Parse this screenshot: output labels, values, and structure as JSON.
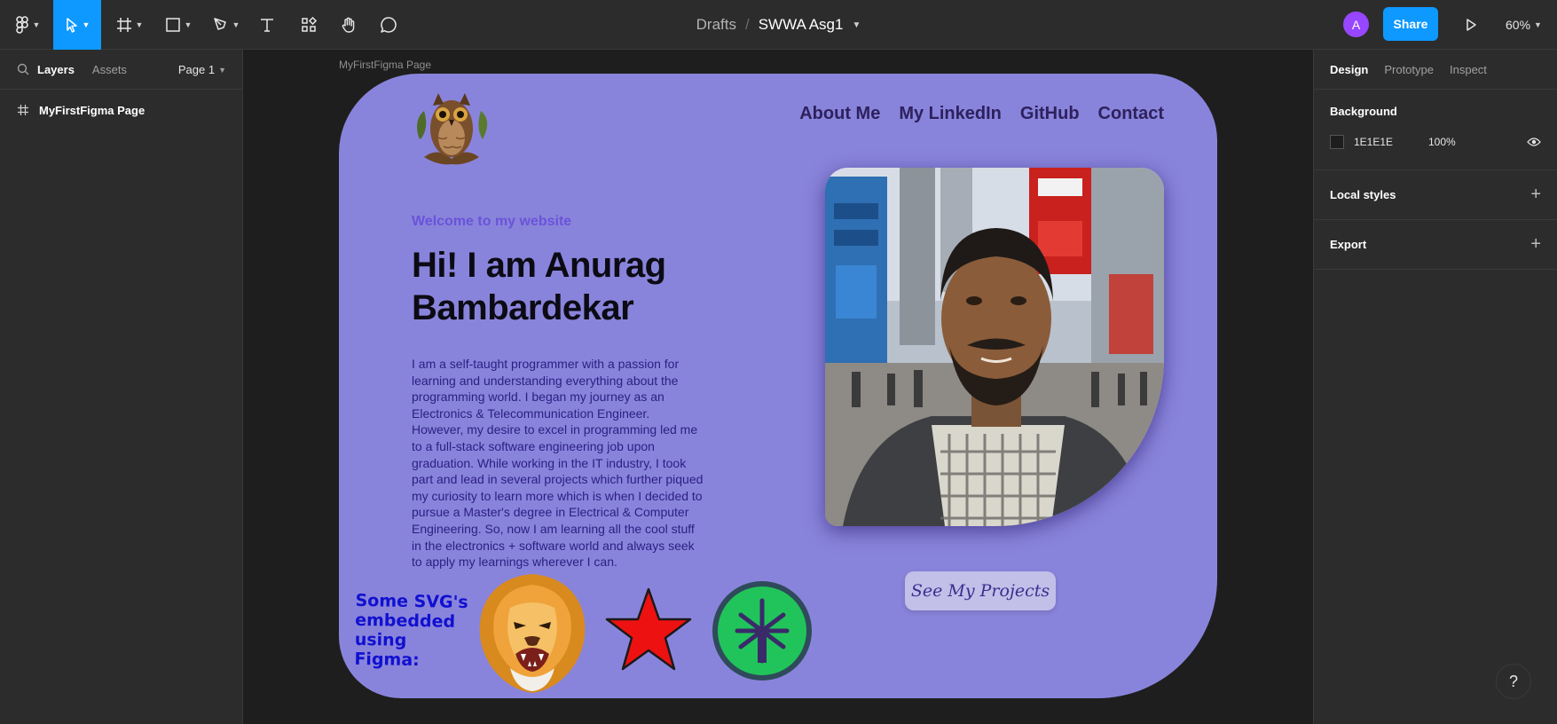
{
  "toolbar": {
    "icons": [
      "figma-menu-icon",
      "move-tool-icon",
      "frame-tool-icon",
      "rectangle-tool-icon",
      "pen-tool-icon",
      "text-tool-icon",
      "resources-icon",
      "hand-tool-icon",
      "comment-icon"
    ],
    "breadcrumb_parent": "Drafts",
    "breadcrumb_sep": "/",
    "file_name": "SWWA Asg1",
    "avatar_initial": "A",
    "share_label": "Share",
    "zoom": "60%",
    "accent_color": "#0d99ff"
  },
  "left_panel": {
    "tabs": [
      "Layers",
      "Assets"
    ],
    "page_selector": "Page 1",
    "layers": [
      {
        "name": "MyFirstFigma Page"
      }
    ]
  },
  "right_panel": {
    "tabs": [
      "Design",
      "Prototype",
      "Inspect"
    ],
    "background_title": "Background",
    "background_hex": "1E1E1E",
    "background_opacity": "100%",
    "local_styles": "Local styles",
    "export": "Export"
  },
  "canvas": {
    "frame_label": "MyFirstFigma Page",
    "frame_color": "#8984db",
    "nav": [
      "About Me",
      "My LinkedIn",
      "GitHub",
      "Contact"
    ],
    "welcome": "Welcome to my website",
    "hero_line1": "Hi! I am Anurag",
    "hero_line2": "Bambardekar",
    "bio": "I am a self-taught programmer with a passion for learning and understanding everything about the programming world. I began my journey as an Electronics & Telecommunication Engineer. However, my desire to excel in programming led me to a full-stack software engineering job upon graduation. While working in the IT industry, I took part and lead in several projects which further piqued my curiosity to learn more which is when I decided to pursue a Master's degree in Electrical & Computer Engineering. So, now I am learning all the cool stuff in the electronics + software world and always seek to apply my learnings wherever I can.",
    "svg_caption": "Some SVG's embedded using Figma:",
    "projects_button": "See My Projects"
  },
  "help_label": "?"
}
